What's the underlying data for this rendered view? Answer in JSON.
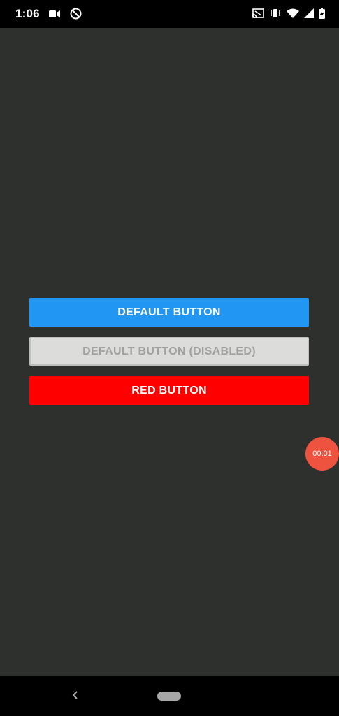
{
  "status_bar": {
    "time": "1:06",
    "left_icons": [
      "video-camera-icon",
      "do-not-disturb-icon"
    ],
    "right_icons": [
      "cast-icon",
      "vibrate-icon",
      "wifi-icon",
      "signal-icon",
      "battery-icon"
    ]
  },
  "buttons": {
    "default_label": "DEFAULT BUTTON",
    "disabled_label": "DEFAULT BUTTON (DISABLED)",
    "red_label": "RED BUTTON"
  },
  "recorder": {
    "timer": "00:01"
  },
  "colors": {
    "background": "#2e302e",
    "default_button": "#2196f3",
    "disabled_button": "#dcddda",
    "red_button": "#ff0000",
    "recorder_badge": "#ee5340"
  }
}
